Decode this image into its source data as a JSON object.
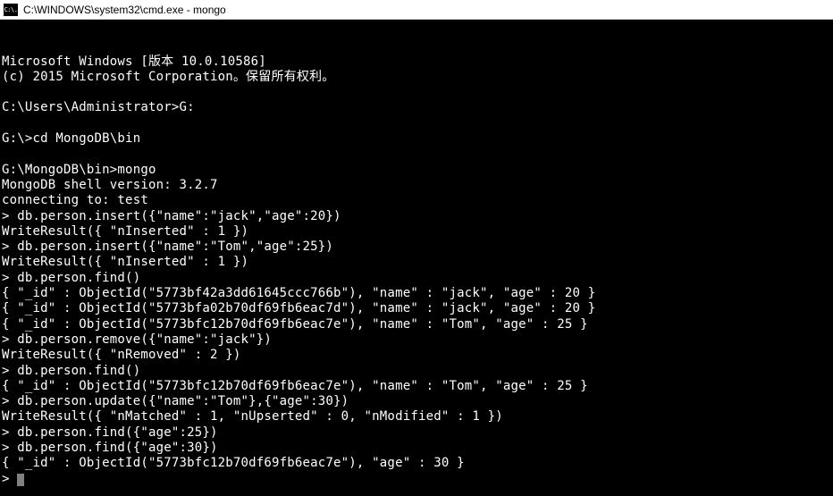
{
  "titlebar": {
    "icon_label": "C:\\.",
    "title": "C:\\WINDOWS\\system32\\cmd.exe - mongo"
  },
  "terminal": {
    "lines": [
      "Microsoft Windows [版本 10.0.10586]",
      "(c) 2015 Microsoft Corporation。保留所有权利。",
      "",
      "C:\\Users\\Administrator>G:",
      "",
      "G:\\>cd MongoDB\\bin",
      "",
      "G:\\MongoDB\\bin>mongo",
      "MongoDB shell version: 3.2.7",
      "connecting to: test",
      "> db.person.insert({\"name\":\"jack\",\"age\":20})",
      "WriteResult({ \"nInserted\" : 1 })",
      "> db.person.insert({\"name\":\"Tom\",\"age\":25})",
      "WriteResult({ \"nInserted\" : 1 })",
      "> db.person.find()",
      "{ \"_id\" : ObjectId(\"5773bf42a3dd61645ccc766b\"), \"name\" : \"jack\", \"age\" : 20 }",
      "{ \"_id\" : ObjectId(\"5773bfa02b70df69fb6eac7d\"), \"name\" : \"jack\", \"age\" : 20 }",
      "{ \"_id\" : ObjectId(\"5773bfc12b70df69fb6eac7e\"), \"name\" : \"Tom\", \"age\" : 25 }",
      "> db.person.remove({\"name\":\"jack\"})",
      "WriteResult({ \"nRemoved\" : 2 })",
      "> db.person.find()",
      "{ \"_id\" : ObjectId(\"5773bfc12b70df69fb6eac7e\"), \"name\" : \"Tom\", \"age\" : 25 }",
      "> db.person.update({\"name\":\"Tom\"},{\"age\":30})",
      "WriteResult({ \"nMatched\" : 1, \"nUpserted\" : 0, \"nModified\" : 1 })",
      "> db.person.find({\"age\":25})",
      "> db.person.find({\"age\":30})",
      "{ \"_id\" : ObjectId(\"5773bfc12b70df69fb6eac7e\"), \"age\" : 30 }",
      "> "
    ]
  }
}
